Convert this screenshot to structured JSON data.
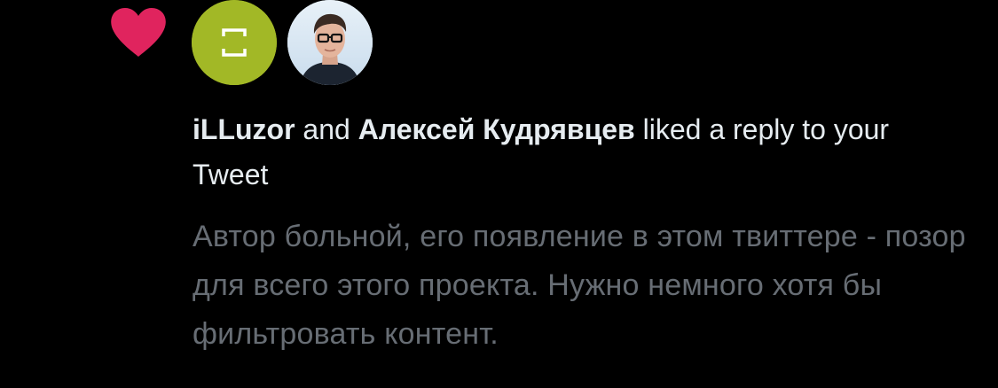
{
  "colors": {
    "background": "#000000",
    "heart": "#e0245e",
    "avatar_1_bg": "#a2b826",
    "primary_text": "#e6ecf0",
    "secondary_text": "#676d74"
  },
  "notification": {
    "icon": "heart-icon",
    "avatars": [
      {
        "icon": "default-avatar-icon"
      },
      {
        "icon": "user-photo"
      }
    ],
    "headline": {
      "actor_1": "iLLuzor",
      "connector": " and ",
      "actor_2": "Алексей Кудрявцев",
      "action": " liked a reply to your Tweet"
    },
    "tweet_text": "Автор больной, его появление в этом твиттере - позор для всего этого проекта. Нужно немного хотя бы фильтровать контент."
  }
}
